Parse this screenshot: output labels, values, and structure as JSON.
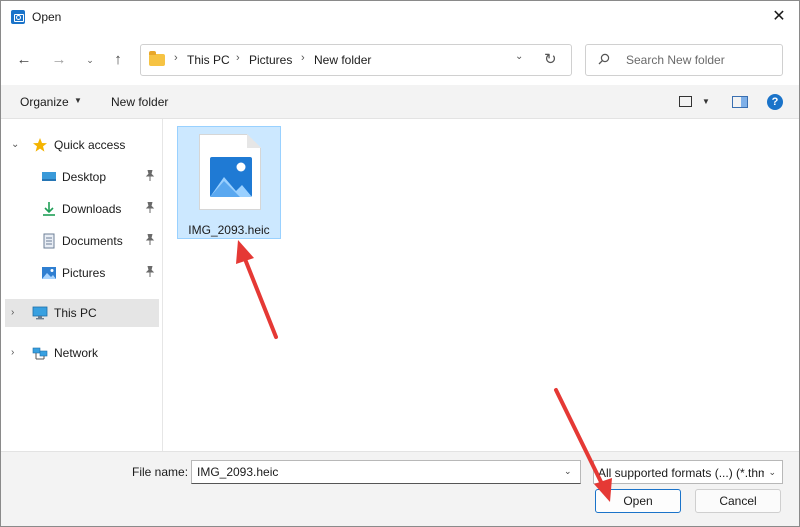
{
  "window": {
    "title": "Open",
    "close_symbol": "✕"
  },
  "nav": {
    "back_symbol": "←",
    "forward_symbol": "→",
    "recent_symbol": "⌄",
    "up_symbol": "↑",
    "breadcrumbs": [
      "This PC",
      "Pictures",
      "New folder"
    ],
    "separator": "›",
    "dropdown_symbol": "⌄",
    "refresh_symbol": "↻",
    "search_placeholder": "Search New folder"
  },
  "commands": {
    "organize": "Organize",
    "organize_caret": "▼",
    "new_folder": "New folder",
    "view_caret": "▼",
    "help_symbol": "?"
  },
  "sidebar": {
    "items": [
      {
        "label": "Quick access",
        "expander": "⌄",
        "icon": "star-icon",
        "pinned": false
      },
      {
        "label": "Desktop",
        "icon": "desktop-icon",
        "pinned": true
      },
      {
        "label": "Downloads",
        "icon": "download-icon",
        "pinned": true
      },
      {
        "label": "Documents",
        "icon": "document-icon",
        "pinned": true
      },
      {
        "label": "Pictures",
        "icon": "pictures-icon",
        "pinned": true
      },
      {
        "label": "This PC",
        "expander": "›",
        "icon": "computer-icon",
        "selected": true
      },
      {
        "label": "Network",
        "expander": "›",
        "icon": "network-icon"
      }
    ],
    "pin_symbol": "📌"
  },
  "files": [
    {
      "name": "IMG_2093.heic",
      "icon": "image-file-icon",
      "selected": true
    }
  ],
  "footer": {
    "file_name_label": "File name:",
    "file_name_value": "IMG_2093.heic",
    "file_type_value": "All supported formats (...) (*.thm",
    "caret_symbol": "⌄",
    "open_label": "Open",
    "cancel_label": "Cancel"
  },
  "colors": {
    "accent": "#1a73c9",
    "selection": "#cce8ff",
    "annotation": "#e53935"
  }
}
